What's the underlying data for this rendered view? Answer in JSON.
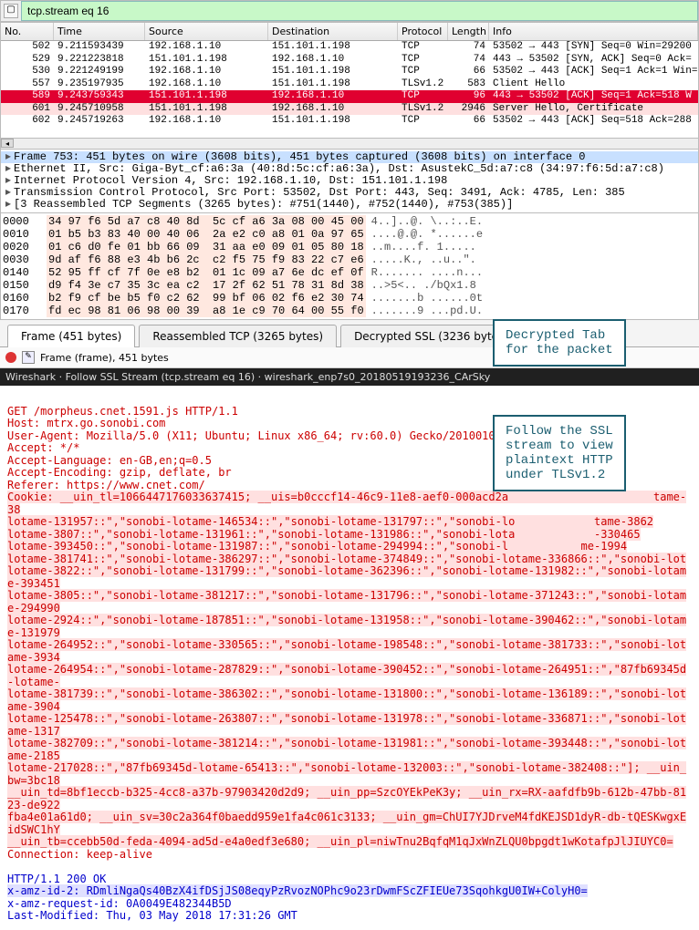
{
  "filter": {
    "text": "tcp.stream eq 16"
  },
  "packet_list": {
    "columns": [
      "No.",
      "Time",
      "Source",
      "Destination",
      "Protocol",
      "Length",
      "Info"
    ],
    "rows": [
      {
        "no": "502",
        "time": "9.211593439",
        "src": "192.168.1.10",
        "dst": "151.101.1.198",
        "proto": "TCP",
        "len": "74",
        "info": "53502 → 443 [SYN] Seq=0 Win=29200",
        "cls": ""
      },
      {
        "no": "529",
        "time": "9.221223818",
        "src": "151.101.1.198",
        "dst": "192.168.1.10",
        "proto": "TCP",
        "len": "74",
        "info": "443 → 53502 [SYN, ACK] Seq=0 Ack=",
        "cls": ""
      },
      {
        "no": "530",
        "time": "9.221249199",
        "src": "192.168.1.10",
        "dst": "151.101.1.198",
        "proto": "TCP",
        "len": "66",
        "info": "53502 → 443 [ACK] Seq=1 Ack=1 Win=",
        "cls": ""
      },
      {
        "no": "557",
        "time": "9.235197935",
        "src": "192.168.1.10",
        "dst": "151.101.1.198",
        "proto": "TLSv1.2",
        "len": "583",
        "info": "Client Hello",
        "cls": ""
      },
      {
        "no": "589",
        "time": "9.243759343",
        "src": "151.101.1.198",
        "dst": "192.168.1.10",
        "proto": "TCP",
        "len": "96",
        "info": "443 → 53502 [ACK] Seq=1 Ack=518 W",
        "cls": "row-red-sel"
      },
      {
        "no": "601",
        "time": "9.245710958",
        "src": "151.101.1.198",
        "dst": "192.168.1.10",
        "proto": "TLSv1.2",
        "len": "2946",
        "info": "Server Hello, Certificate",
        "cls": "row-red"
      },
      {
        "no": "602",
        "time": "9.245719263",
        "src": "192.168.1.10",
        "dst": "151.101.1.198",
        "proto": "TCP",
        "len": "66",
        "info": "53502 → 443 [ACK] Seq=518 Ack=288",
        "cls": ""
      }
    ]
  },
  "proto_tree": {
    "rows": [
      {
        "text": "Frame 753: 451 bytes on wire (3608 bits), 451 bytes captured (3608 bits) on interface 0",
        "sel": true,
        "tw": "▸"
      },
      {
        "text": "Ethernet II, Src: Giga-Byt_cf:a6:3a (40:8d:5c:cf:a6:3a), Dst: AsustekC_5d:a7:c8 (34:97:f6:5d:a7:c8)",
        "sel": false,
        "tw": "▸"
      },
      {
        "text": "Internet Protocol Version 4, Src: 192.168.1.10, Dst: 151.101.1.198",
        "sel": false,
        "tw": "▸"
      },
      {
        "text": "Transmission Control Protocol, Src Port: 53502, Dst Port: 443, Seq: 3491, Ack: 4785, Len: 385",
        "sel": false,
        "tw": "▸"
      },
      {
        "text": "[3 Reassembled TCP Segments (3265 bytes): #751(1440), #752(1440), #753(385)]",
        "sel": false,
        "tw": "▸"
      }
    ]
  },
  "hex": {
    "rows": [
      {
        "off": "0000",
        "bytes": "34 97 f6 5d a7 c8 40 8d  5c cf a6 3a 08 00 45 00",
        "ascii": "4..]..@. \\..:..E."
      },
      {
        "off": "0010",
        "bytes": "01 b5 b3 83 40 00 40 06  2a e2 c0 a8 01 0a 97 65",
        "ascii": "....@.@. *......e"
      },
      {
        "off": "0020",
        "bytes": "01 c6 d0 fe 01 bb 66 09  31 aa e0 09 01 05 80 18",
        "ascii": "..m....f. 1....."
      },
      {
        "off": "0030",
        "bytes": "9d af f6 88 e3 4b b6 2c  c2 f5 75 f9 83 22 c7 e6",
        "ascii": ".....K., ..u..\"."
      },
      {
        "off": "0140",
        "bytes": "52 95 ff cf 7f 0e e8 b2  01 1c 09 a7 6e dc ef 0f",
        "ascii": "R....... ....n..."
      },
      {
        "off": "0150",
        "bytes": "d9 f4 3e c7 35 3c ea c2  17 2f 62 51 78 31 8d 38",
        "ascii": "..>5<.. ./bQx1.8"
      },
      {
        "off": "0160",
        "bytes": "b2 f9 cf be b5 f0 c2 62  99 bf 06 02 f6 e2 30 74",
        "ascii": ".......b ......0t"
      },
      {
        "off": "0170",
        "bytes": "fd ec 98 81 06 98 00 39  a8 1e c9 70 64 00 55 f0",
        "ascii": ".......9 ...pd.U."
      }
    ]
  },
  "tabs": {
    "items": [
      {
        "label": "Frame (451 bytes)",
        "active": true
      },
      {
        "label": "Reassembled TCP (3265 bytes)",
        "active": false
      },
      {
        "label": "Decrypted SSL (3236 bytes)",
        "active": false
      }
    ]
  },
  "status_text": "Frame (frame), 451 bytes",
  "stream_title": "Wireshark · Follow SSL Stream (tcp.stream eq 16) · wireshark_enp7s0_20180519193236_CArSky",
  "stream": {
    "request": {
      "line1": "GET /morpheus.cnet.1591.js HTTP/1.1",
      "host": "Host: mtrx.go.sonobi.com",
      "ua": "User-Agent: Mozilla/5.0 (X11; Ubuntu; Linux x86_64; rv:60.0) Gecko/20100101 Firefox/60.0",
      "accept": "Accept: */*",
      "acceptlang": "Accept-Language: en-GB,en;q=0.5",
      "acceptenc": "Accept-Encoding: gzip, deflate, br",
      "referer": "Referer: https://www.cnet.com/",
      "cookie": "Cookie: __uin_tl=1066447176033637415; __uis=b0cccf14-46c9-11e8-aef0-000acd2a                      tame-38\nlotame-131957::\",\"sonobi-lotame-146534::\",\"sonobi-lotame-131797::\",\"sonobi-lo            tame-3862\nlotame-3807::\",\"sonobi-lotame-131961::\",\"sonobi-lotame-131986::\",\"sonobi-lota            -330465\nlotame-393450::\",\"sonobi-lotame-131987::\",\"sonobi-lotame-294994::\",\"sonobi-l           me-1994\nlotame-381741::\",\"sonobi-lotame-386297::\",\"sonobi-lotame-374849::\",\"sonobi-lotame-336866::\",\"sonobi-lot\nlotame-3822::\",\"sonobi-lotame-131799::\",\"sonobi-lotame-362396::\",\"sonobi-lotame-131982::\",\"sonobi-lotame-393451\nlotame-3805::\",\"sonobi-lotame-381217::\",\"sonobi-lotame-131796::\",\"sonobi-lotame-371243::\",\"sonobi-lotame-294990\nlotame-2924::\",\"sonobi-lotame-187851::\",\"sonobi-lotame-131958::\",\"sonobi-lotame-390462::\",\"sonobi-lotame-131979\nlotame-264952::\",\"sonobi-lotame-330565::\",\"sonobi-lotame-198548::\",\"sonobi-lotame-381733::\",\"sonobi-lotame-3934\nlotame-264954::\",\"sonobi-lotame-287829::\",\"sonobi-lotame-390452::\",\"sonobi-lotame-264951::\",\"87fb69345d-lotame-\nlotame-381739::\",\"sonobi-lotame-386302::\",\"sonobi-lotame-131800::\",\"sonobi-lotame-136189::\",\"sonobi-lotame-3904\nlotame-125478::\",\"sonobi-lotame-263807::\",\"sonobi-lotame-131978::\",\"sonobi-lotame-336871::\",\"sonobi-lotame-1317\nlotame-382709::\",\"sonobi-lotame-381214::\",\"sonobi-lotame-131981::\",\"sonobi-lotame-393448::\",\"sonobi-lotame-2185\nlotame-217028::\",\"87fb69345d-lotame-65413::\",\"sonobi-lotame-132003::\",\"sonobi-lotame-382408::\"]; __uin_bw=3bc18\n__uin_td=8bf1eccb-b325-4cc8-a37b-97903420d2d9; __uin_pp=SzcOYEkPeK3y; __uin_rx=RX-aafdfb9b-612b-47bb-8123-de922\nfba4e01a61d0; __uin_sv=30c2a364f0baedd959e1fa4c061c3133; __uin_gm=ChUI7YJDrveM4fdKEJSD1dyR-db-tQESKwgxEidSWC1hY\n__uin_tb=ccebb50d-feda-4094-ad5d-e4a0edf3e680; __uin_pl=niwTnu2BqfqM1qJxWnZLQU0bpgdt1wKotafpJlJIUYC0=",
      "conn": "Connection: keep-alive"
    },
    "response": {
      "line1": "HTTP/1.1 200 OK",
      "amzid2": "x-amz-id-2: RDmliNgaQs40BzX4ifDSjJS08eqyPzRvozNOPhc9o23rDwmFScZFIEUe73SqohkgU0IW+ColyH0=",
      "reqid": "x-amz-request-id: 0A0049E482344B5D",
      "lastmod": "Last-Modified: Thu, 03 May 2018 17:31:26 GMT"
    }
  },
  "anno1": "Decrypted Tab\nfor the packet",
  "anno2": "Follow the SSL\nstream to view\nplaintext HTTP\nunder TLSv1.2"
}
